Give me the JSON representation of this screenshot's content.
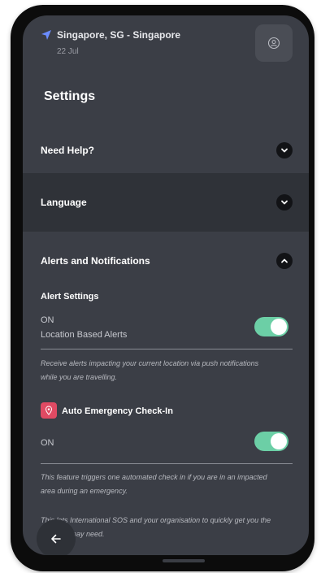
{
  "header": {
    "location": "Singapore, SG - Singapore",
    "date": "22 Jul"
  },
  "page_title": "Settings",
  "sections": {
    "help": {
      "label": "Need Help?",
      "expanded": false
    },
    "language": {
      "label": "Language",
      "expanded": false
    },
    "alerts": {
      "label": "Alerts and Notifications",
      "expanded": true
    }
  },
  "alert_settings": {
    "heading": "Alert Settings",
    "status": "ON",
    "label": "Location Based Alerts",
    "enabled": true,
    "description": "Receive alerts impacting your current location via push notifications while you are travelling."
  },
  "auto_checkin": {
    "label": "Auto Emergency Check-In",
    "status": "ON",
    "enabled": true,
    "description_1": "This feature triggers one automated check in if you are in an impacted area during an emergency.",
    "description_2": "This lets International SOS and your organisation to quickly get you the help you may need."
  },
  "colors": {
    "background": "#3b3e46",
    "highlight_row": "#2f3238",
    "toggle_on": "#6ccfa6",
    "pin_badge": "#e04a63",
    "accent_arrow": "#6b8cff"
  },
  "icons": {
    "location": "navigation-arrow-icon",
    "profile": "profile-settings-icon",
    "chevron_down": "chevron-down-icon",
    "chevron_up": "chevron-up-icon",
    "pin": "location-pin-icon",
    "back": "back-arrow-icon"
  }
}
